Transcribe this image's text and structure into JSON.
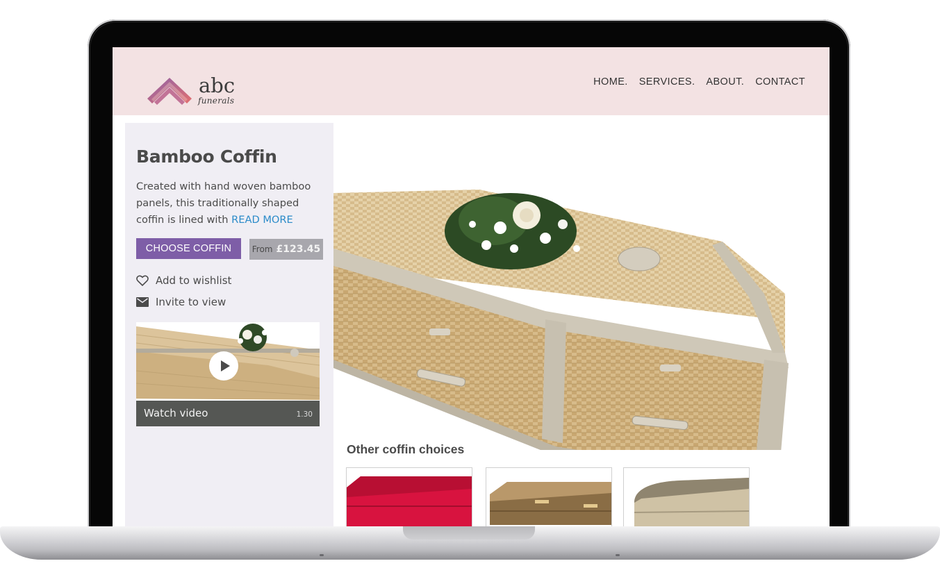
{
  "header": {
    "logo_word": "abc",
    "logo_sub": "funerals",
    "nav": [
      "HOME.",
      "SERVICES.",
      "ABOUT.",
      "CONTACT"
    ]
  },
  "product": {
    "title": "Bamboo Coffin",
    "description": "Created with hand woven bamboo panels, this traditionally shaped coffin is lined with",
    "read_more": "READ MORE",
    "choose_label": "CHOOSE COFFIN",
    "price_prefix": "From",
    "price": "£123.45",
    "wishlist_label": "Add to wishlist",
    "invite_label": "Invite to view",
    "video_label": "Watch video",
    "video_duration": "1.30"
  },
  "other": {
    "title": "Other coffin choices",
    "items": [
      {
        "icon": "red-wicker-coffin-image"
      },
      {
        "icon": "willow-coffin-image"
      },
      {
        "icon": "light-wicker-coffin-image"
      }
    ]
  },
  "colors": {
    "header_bg": "#f3e2e3",
    "accent_purple": "#7e5ea7",
    "link_blue": "#2b8bc9",
    "sidebar_bg": "#f0eef4"
  }
}
